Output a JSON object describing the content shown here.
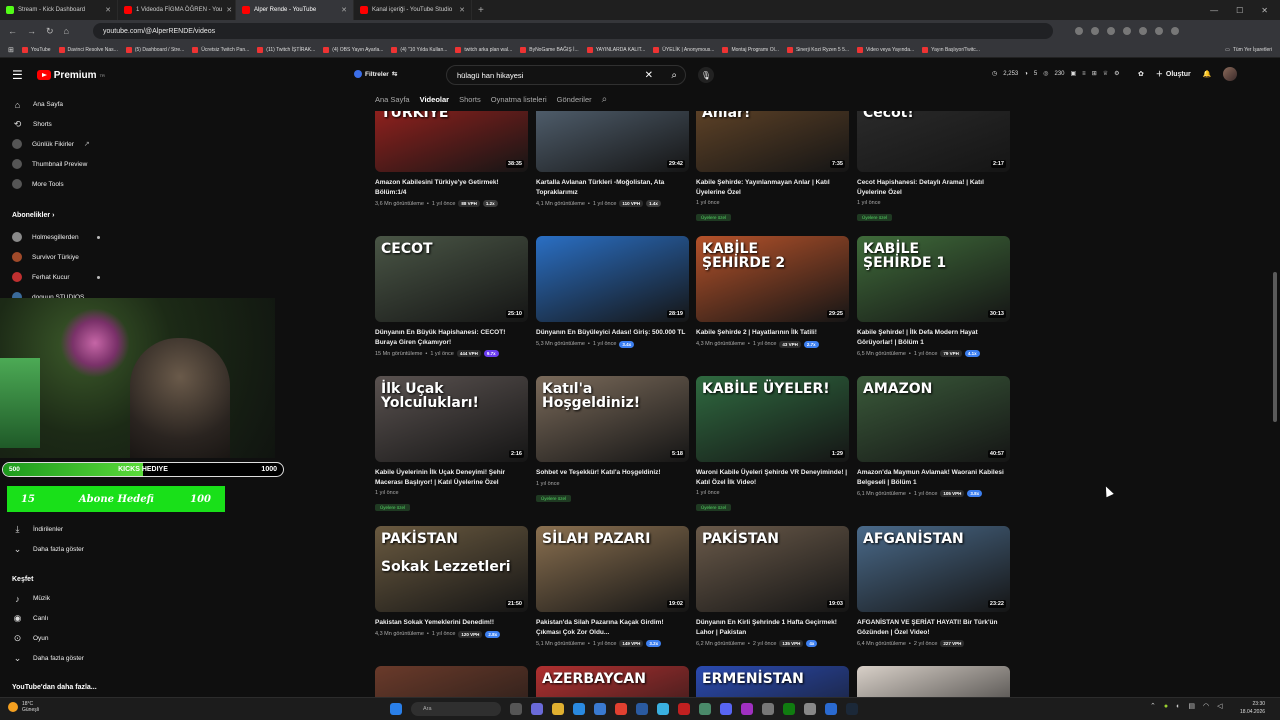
{
  "browser": {
    "tabs": [
      {
        "title": "Stream - Kick Dashboard",
        "color": "#53fc18",
        "active": false
      },
      {
        "title": "1 Videoda FİGMA ÖĞREN - You",
        "color": "#ff0000",
        "active": false
      },
      {
        "title": "Alper Rende - YouTube",
        "color": "#ff0000",
        "active": true
      },
      {
        "title": "Kanal içeriği - YouTube Studio",
        "color": "#ff0000",
        "active": false
      }
    ],
    "url": "youtube.com/@AlperRENDE/videos",
    "bookmarks": [
      "YouTube",
      "Davinci Resolve Nas...",
      "(5) Dashboard / Stre...",
      "Ücretsiz Twitch Pan...",
      "(11) Twitch İŞTİRAK...",
      "(4) OBS Yayın Ayarla...",
      "(4) \"10 Yılda Kullan...",
      "twitch arka plan wal...",
      "ByNoGame BAĞIŞ İ...",
      "YAYINLARDA KALIT...",
      "ÜYELİK | Anonymous...",
      "Montaj Programı Ol...",
      "Sinerji Kozi Ryzen 5 5...",
      "Video veya Yayında...",
      "Yayın Başlıyor/Twitc..."
    ],
    "all_bookmarks": "Tüm Yer İşaretleri"
  },
  "header": {
    "brand": "Premium",
    "brand_sup": "TR",
    "filters": "Filtreler",
    "search_value": "hülagü han hikayesi",
    "stats": [
      "2,253",
      "5",
      "230"
    ],
    "create": "Oluştur"
  },
  "channel_tabs": [
    "Ana Sayfa",
    "Videolar",
    "Shorts",
    "Oynatma listeleri",
    "Gönderiler"
  ],
  "sidebar": {
    "top": [
      "Ana Sayfa",
      "Shorts",
      "Günlük Fikirler",
      "Thumbnail Preview",
      "More Tools"
    ],
    "subs_header": "Abonelikler",
    "subs": [
      "Holmesgillerden",
      "Survivor Türkiye",
      "Ferhat Kucur",
      "doguun STUDIOS"
    ],
    "you": [
      "İndirilenler",
      "Daha fazla göster"
    ],
    "explore_header": "Keşfet",
    "explore": [
      "Müzik",
      "Canlı",
      "Oyun",
      "Daha fazla göster"
    ],
    "more": "YouTube'dan daha fazla..."
  },
  "overlay": {
    "hediye_left": "500",
    "hediye_mid": "KICKS HEDIYE",
    "hediye_right": "1000",
    "hediye_progress": 0.5,
    "hedef_left": "15",
    "hedef_mid": "Abone Hedefi",
    "hedef_right": "100"
  },
  "videos": [
    {
      "thumb": "AMAZON\nTÜRKİYE",
      "dur": "38:35",
      "title": "Amazon Kabilesini Türkiye'ye Getirmek! Bölüm:1/4",
      "views": "3,6 Mn görüntüleme",
      "age": "1 yıl önce",
      "vph": "88 VPH",
      "mul": "1.2x",
      "mc": "g",
      "badge": "",
      "bg": "#a8231f"
    },
    {
      "thumb": "",
      "dur": "29:42",
      "title": "Kartalla Avlanan Türkleri -Moğolistan, Ata Topraklarımız",
      "views": "4,1 Mn görüntüleme",
      "age": "1 yıl önce",
      "vph": "110 VPH",
      "mul": "1.4x",
      "mc": "g",
      "badge": "",
      "bg": "#5a6b7c"
    },
    {
      "thumb": "Yayınlanmayan\nAnlar!",
      "dur": "7:35",
      "title": "Kabile Şehirde: Yayınlanmayan Anlar | Katıl Üyelerine Özel",
      "views": "",
      "age": "1 yıl önce",
      "vph": "",
      "mul": "",
      "mc": "",
      "badge": "Üyelere özel",
      "bg": "#6b4a2a"
    },
    {
      "thumb": "Katıl Özel\nCecot!",
      "dur": "2:17",
      "title": "Cecot Hapishanesi: Detaylı Arama! | Katıl Üyelerine Özel",
      "views": "",
      "age": "1 yıl önce",
      "vph": "",
      "mul": "",
      "mc": "",
      "badge": "Üyelere özel",
      "bg": "#2e2e2e"
    },
    {
      "thumb": "CECOT",
      "dur": "25:10",
      "title": "Dünyanın En Büyük Hapishanesi: CECOT! Buraya Giren Çıkamıyor!",
      "views": "15 Mn görüntüleme",
      "age": "1 yıl önce",
      "vph": "444 VPH",
      "mul": "9.7x",
      "mc": "p",
      "badge": "",
      "bg": "#4a5646"
    },
    {
      "thumb": "",
      "dur": "28:19",
      "title": "Dünyanın En Büyüleyici Adası! Giriş: 500.000 TL",
      "views": "5,3 Mn görüntüleme",
      "age": "1 yıl önce",
      "vph": "",
      "mul": "3.4x",
      "mc": "b",
      "badge": "",
      "bg": "#2a6fc4"
    },
    {
      "thumb": "KABİLE\nŞEHİRDE 2",
      "dur": "29:25",
      "title": "Kabile Şehirde 2 | Hayatlarının İlk Tatili!",
      "views": "4,3 Mn görüntüleme",
      "age": "1 yıl önce",
      "vph": "43 VPH",
      "mul": "2.7x",
      "mc": "b",
      "badge": "",
      "bg": "#b5522a"
    },
    {
      "thumb": "KABİLE\nŞEHİRDE 1",
      "dur": "30:13",
      "title": "Kabile Şehirde! | İlk Defa Modern Hayat Görüyorlar! | Bölüm 1",
      "views": "6,5 Mn görüntüleme",
      "age": "1 yıl önce",
      "vph": "79 VPH",
      "mul": "4.1x",
      "mc": "b",
      "badge": "",
      "bg": "#3f6b3a"
    },
    {
      "thumb": "İlk Uçak\nYolculukları!",
      "dur": "2:16",
      "title": "Kabile Üyelerinin İlk Uçak Deneyimi! Şehir Macerası Başlıyor! | Katıl Üyelerine Özel",
      "views": "",
      "age": "1 yıl önce",
      "vph": "",
      "mul": "",
      "mc": "",
      "badge": "Üyelere özel",
      "bg": "#5a5250"
    },
    {
      "thumb": "Katıl'a\nHoşgeldiniz!",
      "dur": "5:18",
      "title": "Sohbet ve Teşekkür! Katıl'a Hoşgeldiniz!",
      "views": "",
      "age": "1 yıl önce",
      "vph": "",
      "mul": "",
      "mc": "",
      "badge": "Üyelere özel",
      "bg": "#7a6a5a"
    },
    {
      "thumb": "KABİLE ÜYELER!",
      "dur": "1:29",
      "title": "Waroni Kabile Üyeleri Şehirde VR Deneyiminde! | Katıl Özel İlk Video!",
      "views": "",
      "age": "1 yıl önce",
      "vph": "",
      "mul": "",
      "mc": "",
      "badge": "Üyelere özel",
      "bg": "#2f6a40"
    },
    {
      "thumb": "AMAZON",
      "dur": "40:57",
      "title": "Amazon'da Maymun Avlamak! Waorani Kabilesi Belgeseli | Bölüm 1",
      "views": "6,1 Mn görüntüleme",
      "age": "1 yıl önce",
      "vph": "105 VPH",
      "mul": "3.8x",
      "mc": "b",
      "badge": "",
      "bg": "#3a5a3a"
    },
    {
      "thumb": "PAKİSTAN\n\nSokak Lezzetleri",
      "dur": "21:50",
      "title": "Pakistan Sokak Yemeklerini Denedim!!",
      "views": "4,3 Mn görüntüleme",
      "age": "1 yıl önce",
      "vph": "120 VPH",
      "mul": "2.8x",
      "mc": "b",
      "badge": "",
      "bg": "#6a5a40"
    },
    {
      "thumb": "SİLAH PAZARI",
      "dur": "19:02",
      "title": "Pakistan'da Silah Pazarına Kaçak Girdim! Çıkması Çok Zor Oldu...",
      "views": "5,1 Mn görüntüleme",
      "age": "1 yıl önce",
      "vph": "149 VPH",
      "mul": "3.2x",
      "mc": "b",
      "badge": "",
      "bg": "#8a7050"
    },
    {
      "thumb": "PAKİSTAN",
      "dur": "19:03",
      "title": "Dünyanın En Kirli Şehrinde 1 Hafta Geçirmek! Lahor | Pakistan",
      "views": "6,2 Mn görüntüleme",
      "age": "2 yıl önce",
      "vph": "135 VPH",
      "mul": "4x",
      "mc": "b",
      "badge": "",
      "bg": "#6a5a4a"
    },
    {
      "thumb": "AFGANİSTAN",
      "dur": "23:22",
      "title": "AFGANİSTAN VE ŞERİAT HAYATI! Bir Türk'ün Gözünden | Özel Video!",
      "views": "6,4 Mn görüntüleme",
      "age": "2 yıl önce",
      "vph": "227 VPH",
      "mul": "",
      "mc": "",
      "badge": "",
      "bg": "#4a6a8a"
    },
    {
      "thumb": "",
      "dur": "",
      "title": "",
      "views": "",
      "age": "",
      "vph": "",
      "mul": "",
      "mc": "",
      "badge": "",
      "bg": "#6a3a2a"
    },
    {
      "thumb": "AZERBAYCAN",
      "dur": "",
      "title": "",
      "views": "",
      "age": "",
      "vph": "",
      "mul": "",
      "mc": "",
      "badge": "",
      "bg": "#b03030"
    },
    {
      "thumb": "ERMENİSTAN",
      "dur": "",
      "title": "",
      "views": "",
      "age": "",
      "vph": "",
      "mul": "",
      "mc": "",
      "badge": "",
      "bg": "#2a4ab0"
    },
    {
      "thumb": "",
      "dur": "",
      "title": "",
      "views": "",
      "age": "",
      "vph": "",
      "mul": "",
      "mc": "",
      "badge": "",
      "bg": "#d8d0c8"
    }
  ],
  "taskbar": {
    "temp": "18°C",
    "weather": "Güneşli",
    "search": "Ara",
    "time": "23:30",
    "date": "18.04.2026"
  }
}
